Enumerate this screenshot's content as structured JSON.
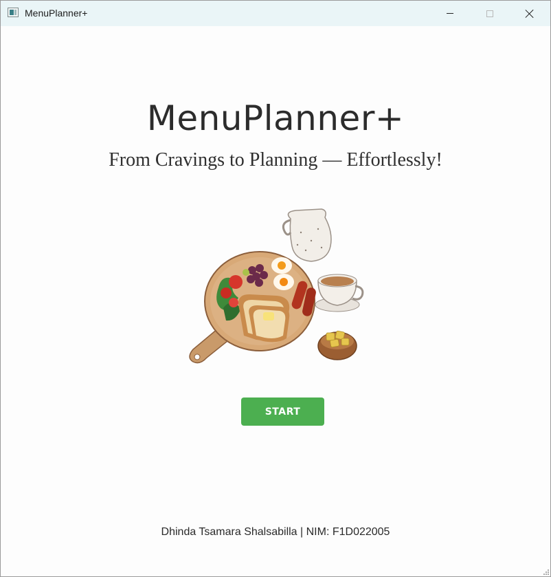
{
  "window": {
    "title": "MenuPlanner+",
    "controls": [
      "minimize-icon",
      "maximize-icon",
      "close-icon"
    ]
  },
  "main": {
    "heading": "MenuPlanner+",
    "tagline": "From Cravings to Planning — Effortlessly!",
    "illustration_icon": "breakfast-illustration",
    "start_label": "START",
    "footer": "Dhinda Tsamara Shalsabilla | NIM: F1D022005"
  },
  "colors": {
    "titlebar": "#eaf5f7",
    "start_button": "#4caf50",
    "background": "#fdfdfd"
  }
}
